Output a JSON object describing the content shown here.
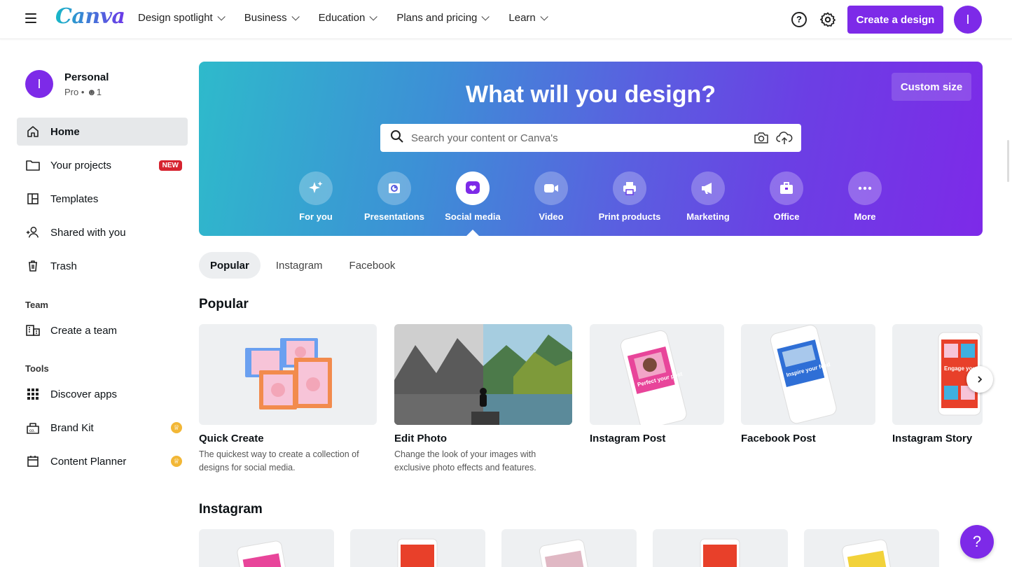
{
  "brand": {
    "logo": "Canva",
    "accent": "#7d2ae8"
  },
  "nav": [
    "Design spotlight",
    "Business",
    "Education",
    "Plans and pricing",
    "Learn"
  ],
  "header": {
    "create_label": "Create a design",
    "avatar_initial": "I"
  },
  "account": {
    "initial": "I",
    "name": "Personal",
    "plan": "Pro • ",
    "members": "1"
  },
  "sidebar": {
    "items": [
      {
        "label": "Home"
      },
      {
        "label": "Your projects",
        "badge": "NEW"
      },
      {
        "label": "Templates"
      },
      {
        "label": "Shared with you"
      },
      {
        "label": "Trash"
      }
    ],
    "team_heading": "Team",
    "team_items": [
      {
        "label": "Create a team"
      }
    ],
    "tools_heading": "Tools",
    "tools_items": [
      {
        "label": "Discover apps"
      },
      {
        "label": "Brand Kit"
      },
      {
        "label": "Content Planner"
      }
    ]
  },
  "hero": {
    "title": "What will you design?",
    "custom_size": "Custom size",
    "search_placeholder": "Search your content or Canva's",
    "categories": [
      "For you",
      "Presentations",
      "Social media",
      "Video",
      "Print products",
      "Marketing",
      "Office",
      "More"
    ]
  },
  "tabs": [
    "Popular",
    "Instagram",
    "Facebook"
  ],
  "popular": {
    "title": "Popular",
    "cards": [
      {
        "title": "Quick Create",
        "desc": "The quickest way to create a collection of designs for social media."
      },
      {
        "title": "Edit Photo",
        "desc": "Change the look of your images with exclusive photo effects and features."
      },
      {
        "title": "Instagram Post",
        "desc": "",
        "art": "Perfect your post"
      },
      {
        "title": "Facebook Post",
        "desc": "",
        "art": "Inspire your feed"
      },
      {
        "title": "Instagram Story",
        "desc": "",
        "art": "Engage your Audien"
      }
    ]
  },
  "instagram": {
    "title": "Instagram"
  },
  "help_fab": "?"
}
